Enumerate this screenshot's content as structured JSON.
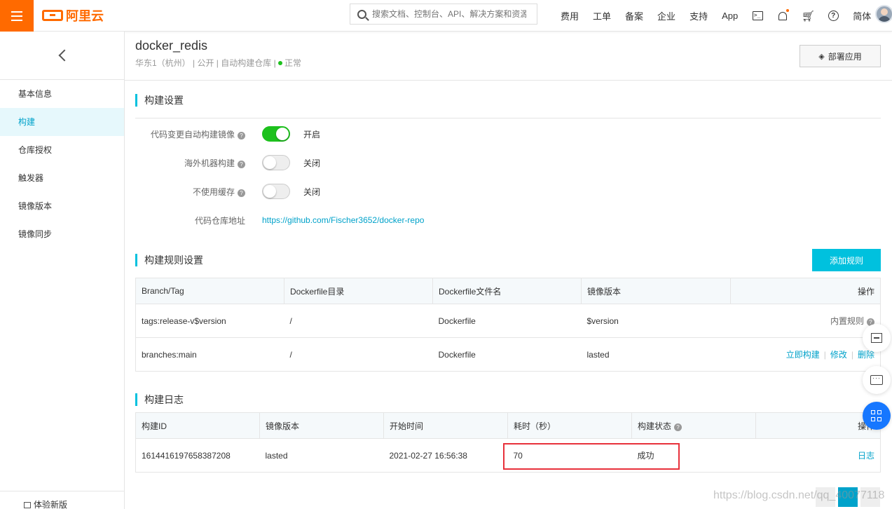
{
  "topbar": {
    "brand": "阿里云",
    "search_placeholder": "搜索文档、控制台、API、解决方案和资源",
    "nav": [
      "费用",
      "工单",
      "备案",
      "企业",
      "支持",
      "App"
    ],
    "icons": [
      "terminal-icon",
      "bell-icon",
      "cart-icon",
      "help-icon"
    ],
    "lang": "简体",
    "accent": "#ff6a00"
  },
  "sidebar": {
    "items": [
      {
        "label": "基本信息"
      },
      {
        "label": "构建"
      },
      {
        "label": "仓库授权"
      },
      {
        "label": "触发器"
      },
      {
        "label": "镜像版本"
      },
      {
        "label": "镜像同步"
      }
    ],
    "active_index": 1,
    "footer": "体验新版"
  },
  "repo": {
    "name": "docker_redis",
    "meta": "华东1（杭州） | 公开 | 自动构建仓库 |",
    "status": "正常",
    "deploy_label": "部署应用"
  },
  "build_settings": {
    "title": "构建设置",
    "rows": [
      {
        "label": "代码变更自动构建镜像",
        "state": "开启",
        "on": true
      },
      {
        "label": "海外机器构建",
        "state": "关闭",
        "on": false
      },
      {
        "label": "不使用缓存",
        "state": "关闭",
        "on": false
      }
    ],
    "repo_addr_label": "代码仓库地址",
    "repo_addr": "https://github.com/Fischer3652/docker-repo"
  },
  "build_rules": {
    "title": "构建规则设置",
    "add_label": "添加规则",
    "columns": [
      "Branch/Tag",
      "Dockerfile目录",
      "Dockerfile文件名",
      "镜像版本",
      "操作"
    ],
    "rows": [
      {
        "branch": "tags:release-v$version",
        "dir": "/",
        "file": "Dockerfile",
        "version": "$version",
        "op": "内置规则"
      },
      {
        "branch": "branches:main",
        "dir": "/",
        "file": "Dockerfile",
        "version": "lasted",
        "actions": [
          "立即构建",
          "修改",
          "删除"
        ]
      }
    ]
  },
  "build_log": {
    "title": "构建日志",
    "columns": [
      "构建ID",
      "镜像版本",
      "开始时间",
      "耗时（秒）",
      "构建状态",
      "操作"
    ],
    "rows": [
      {
        "id": "1614416197658387208",
        "version": "lasted",
        "start": "2021-02-27 16:56:38",
        "duration": "70",
        "status": "成功",
        "action": "日志"
      }
    ]
  },
  "watermark": "https://blog.csdn.net/qq_40077118"
}
